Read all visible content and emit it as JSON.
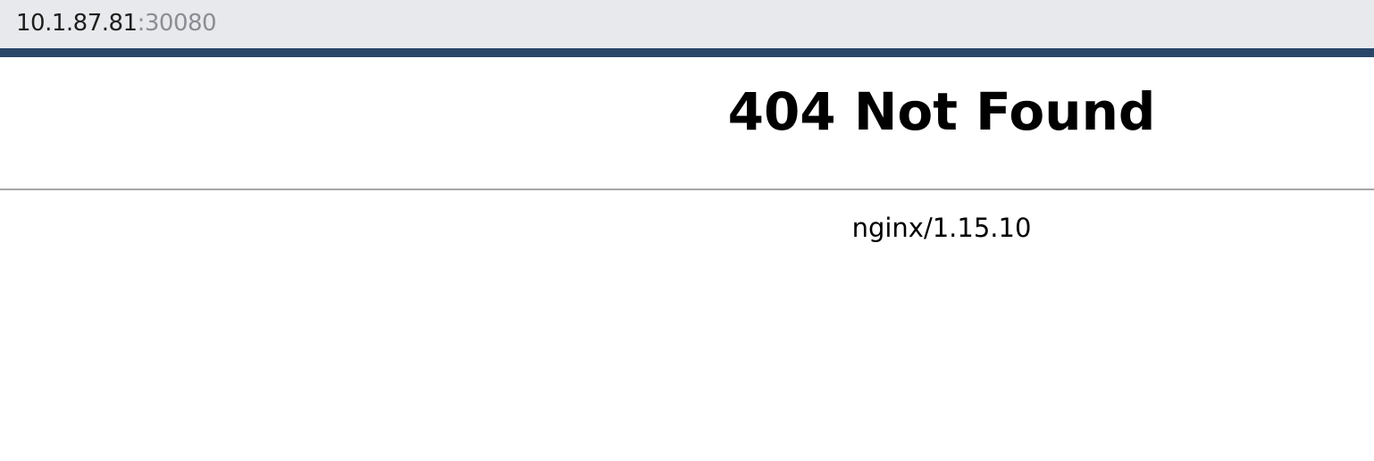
{
  "browser": {
    "address": {
      "host": "10.1.87.81",
      "port": ":30080"
    }
  },
  "page": {
    "title": "404 Not Found",
    "server": "nginx/1.15.10"
  },
  "colors": {
    "address_bar_bg": "#e8e9ec",
    "accent_bar": "#2a4769",
    "host_text": "#1e1e1e",
    "port_text": "#8a8d93",
    "divider": "#a6a6a6"
  }
}
